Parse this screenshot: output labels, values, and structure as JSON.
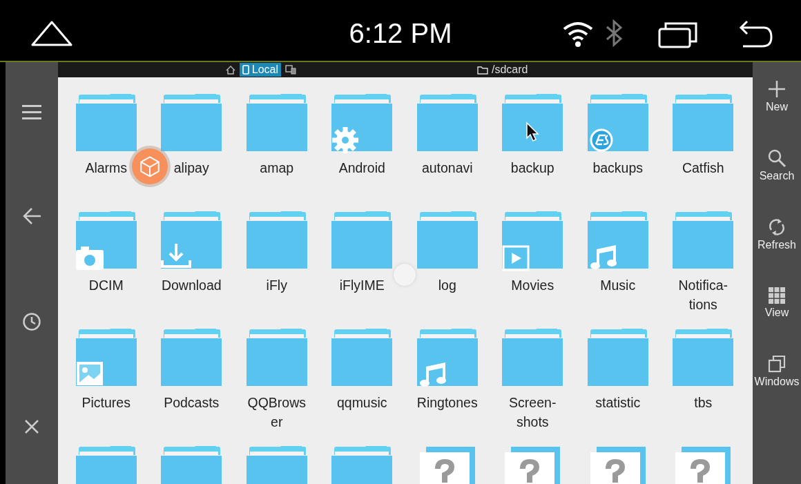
{
  "status_bar": {
    "time": "6:12 PM"
  },
  "path_bar": {
    "tabs": [
      {
        "label": "Local",
        "selected": true
      }
    ],
    "path": "/sdcard"
  },
  "toolbar": [
    {
      "label": "New",
      "kind": "plus"
    },
    {
      "label": "Search",
      "kind": "search"
    },
    {
      "label": "Refresh",
      "kind": "refresh"
    },
    {
      "label": "View",
      "kind": "grid"
    },
    {
      "label": "Windows",
      "kind": "windows"
    }
  ],
  "files": [
    {
      "name": "Alarms",
      "kind": "folder"
    },
    {
      "name": "alipay",
      "kind": "folder"
    },
    {
      "name": "amap",
      "kind": "folder"
    },
    {
      "name": "Android",
      "kind": "folder",
      "badge": {
        "kind": "gear"
      }
    },
    {
      "name": "autonavi",
      "kind": "folder"
    },
    {
      "name": "backup",
      "kind": "folder"
    },
    {
      "name": "backups",
      "kind": "folder",
      "badge": {
        "kind": "es"
      }
    },
    {
      "name": "Catfish",
      "kind": "folder"
    },
    {
      "name": "DCIM",
      "kind": "folder",
      "badge": {
        "kind": "camera"
      }
    },
    {
      "name": "Download",
      "kind": "folder",
      "badge": {
        "kind": "download"
      }
    },
    {
      "name": "iFly",
      "kind": "folder"
    },
    {
      "name": "iFlyIME",
      "kind": "folder"
    },
    {
      "name": "log",
      "kind": "folder"
    },
    {
      "name": "Movies",
      "kind": "folder",
      "badge": {
        "kind": "play"
      }
    },
    {
      "name": "Music",
      "kind": "folder",
      "badge": {
        "kind": "music"
      }
    },
    {
      "name": "Notifica-\ntions",
      "kind": "folder"
    },
    {
      "name": "Pictures",
      "kind": "folder",
      "badge": {
        "kind": "image"
      }
    },
    {
      "name": "Podcasts",
      "kind": "folder"
    },
    {
      "name": "QQBrows\ner",
      "kind": "folder"
    },
    {
      "name": "qqmusic",
      "kind": "folder"
    },
    {
      "name": "Ringtones",
      "kind": "folder",
      "badge": {
        "kind": "music"
      }
    },
    {
      "name": "Screen-\nshots",
      "kind": "folder"
    },
    {
      "name": "statistic",
      "kind": "folder"
    },
    {
      "name": "tbs",
      "kind": "folder"
    },
    {
      "kind": "folder"
    },
    {
      "kind": "folder"
    },
    {
      "kind": "folder"
    },
    {
      "kind": "folder"
    },
    {
      "kind": "unknown"
    },
    {
      "kind": "unknown"
    },
    {
      "kind": "unknown"
    },
    {
      "kind": "unknown"
    }
  ]
}
